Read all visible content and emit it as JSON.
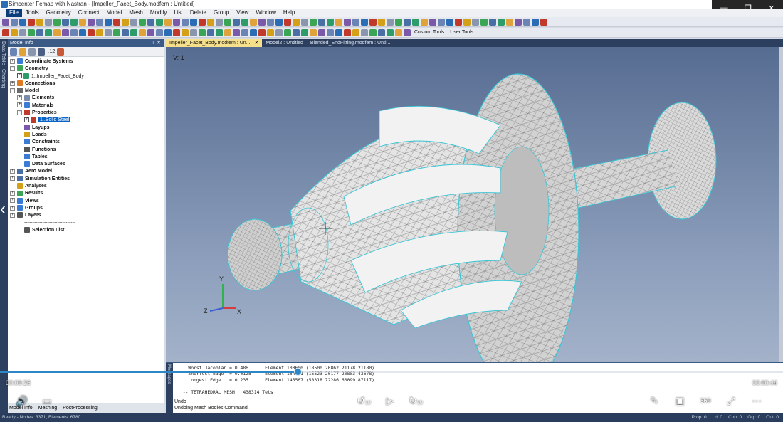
{
  "window": {
    "title": "Simcenter Femap with Nastran - [Impeller_Facet_Body.modfem : Untitled]"
  },
  "menu": [
    "File",
    "Tools",
    "Geometry",
    "Connect",
    "Model",
    "Mesh",
    "Modify",
    "List",
    "Delete",
    "Group",
    "View",
    "Window",
    "Help"
  ],
  "toolbar2": {
    "custom_tools": "Custom Tools",
    "user_tools": "User Tools"
  },
  "side_tabs": {
    "data_table": "Data Table",
    "charting": "Charting"
  },
  "model_info": {
    "title": "Model Info",
    "count_label": "12",
    "tree": [
      {
        "label": "Coordinate Systems",
        "depth": 0,
        "expander": "+",
        "icon_color": "#3a7bd5"
      },
      {
        "label": "Geometry",
        "depth": 0,
        "expander": "−",
        "icon_color": "#3aa655"
      },
      {
        "label": "1..Impeller_Facet_Body",
        "depth": 1,
        "checkbox": "✓",
        "icon_color": "#2e9c6a",
        "normal": true
      },
      {
        "label": "Connections",
        "depth": 0,
        "expander": "+",
        "icon_color": "#e07a1f"
      },
      {
        "label": "Model",
        "depth": 0,
        "expander": "−",
        "icon_color": "#6a6a6a"
      },
      {
        "label": "Elements",
        "depth": 1,
        "expander": "+",
        "icon_color": "#7b8aa8"
      },
      {
        "label": "Materials",
        "depth": 1,
        "expander": "+",
        "icon_color": "#3a7bd5"
      },
      {
        "label": "Properties",
        "depth": 1,
        "expander": "−",
        "icon_color": "#c0392b"
      },
      {
        "label": "1..Solid Steel",
        "depth": 2,
        "checkbox": "✓",
        "icon_color": "#c0392b",
        "selected": true,
        "normal": true
      },
      {
        "label": "Layups",
        "depth": 1,
        "icon_color": "#7a5aa8"
      },
      {
        "label": "Loads",
        "depth": 1,
        "icon_color": "#d4a017"
      },
      {
        "label": "Constraints",
        "depth": 1,
        "icon_color": "#3a7bd5"
      },
      {
        "label": "Functions",
        "depth": 1,
        "icon_color": "#555555"
      },
      {
        "label": "Tables",
        "depth": 1,
        "icon_color": "#3a7bd5"
      },
      {
        "label": "Data Surfaces",
        "depth": 1,
        "icon_color": "#3a7bd5"
      },
      {
        "label": "Aero Model",
        "depth": 0,
        "expander": "+",
        "icon_color": "#4a6fa5"
      },
      {
        "label": "Simulation Entities",
        "depth": 0,
        "expander": "+",
        "icon_color": "#4a6fa5"
      },
      {
        "label": "Analyses",
        "depth": 0,
        "icon_color": "#d4a017"
      },
      {
        "label": "Results",
        "depth": 0,
        "expander": "+",
        "icon_color": "#3aa655"
      },
      {
        "label": "Views",
        "depth": 0,
        "expander": "+",
        "icon_color": "#3a7bd5"
      },
      {
        "label": "Groups",
        "depth": 0,
        "expander": "+",
        "icon_color": "#3a7bd5"
      },
      {
        "label": "Layers",
        "depth": 0,
        "expander": "+",
        "icon_color": "#555555"
      },
      {
        "label": "-------------------------------",
        "depth": 1,
        "normal": true
      },
      {
        "label": "Selection List",
        "depth": 1,
        "icon_color": "#555555"
      }
    ],
    "bottom_tabs": [
      "Model Info",
      "Meshing",
      "PostProcessing"
    ]
  },
  "tabs": [
    {
      "label": "Impeller_Facet_Body.modfem : Un...",
      "active": true,
      "close": "✕"
    },
    {
      "label": "Model2 : Untitled",
      "active": false
    },
    {
      "label": "Blended_EndFitting.modfem : Unti...",
      "active": false
    }
  ],
  "viewport": {
    "view_label": "V: 1",
    "axes": {
      "x": "X",
      "y": "Y",
      "z": "Z"
    }
  },
  "messages": {
    "side_label": "Messages",
    "lines": [
      "    Worst Jacobian = 0.486      Element 100600 (18500 20862 21178 21180)",
      "    Shortest Edge  = 0.0125     Element 134231 (15523 20177 20803 43678)",
      "    Longest Edge   = 0.235      Element 145567 (58318 72286 60099 87117)",
      "",
      "  -- TETRAHEDRAL MESH   438314 Tets"
    ],
    "undo_title": "Undo",
    "undo_text": "Undoing Mesh Bodies Command."
  },
  "status": {
    "left": "Ready - Nodes: 3371, Elements: 6780",
    "right": [
      "Prop: 0",
      "Ld: 0",
      "Con: 0",
      "Grp: 0",
      "Out: 0"
    ]
  },
  "player": {
    "elapsed": "00:00:26",
    "total": "00:00:44",
    "progress": 0.38,
    "rewind_label": "10",
    "forward_label": "30",
    "vr_label": "360"
  }
}
